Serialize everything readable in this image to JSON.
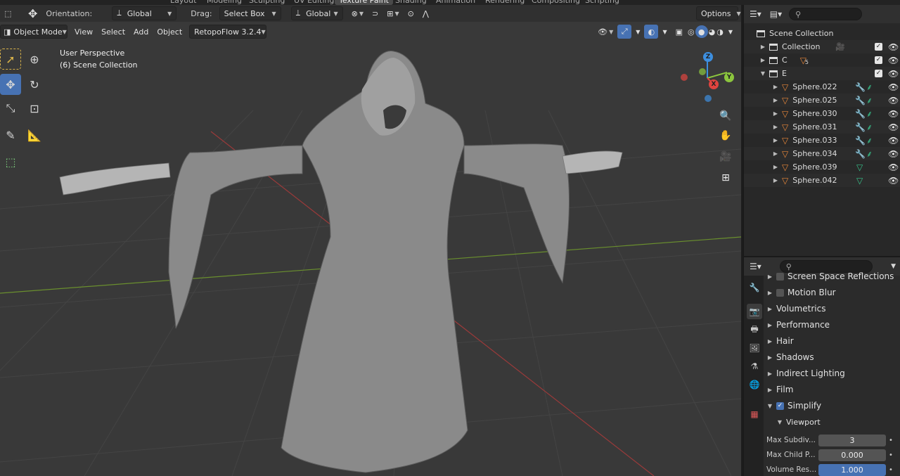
{
  "workspace_tabs": [
    "Layout",
    "Modeling",
    "Sculpting",
    "UV Editing",
    "Texture Paint",
    "Shading",
    "Animation",
    "Rendering",
    "Compositing",
    "Scripting"
  ],
  "active_workspace": "Texture Paint",
  "tool_header": {
    "orientation_label": "Orientation:",
    "orientation_value": "Global",
    "drag_label": "Drag:",
    "drag_value": "Select Box",
    "transform_value": "Global",
    "options_label": "Options"
  },
  "view_header": {
    "mode": "Object Mode",
    "menus": [
      "View",
      "Select",
      "Add",
      "Object"
    ],
    "addon": "RetopoFlow 3.2.4"
  },
  "overlay": {
    "line1": "User Perspective",
    "line2": "(6) Scene Collection"
  },
  "gizmo": {
    "x": "X",
    "y": "Y",
    "z": "Z"
  },
  "outliner": {
    "root": "Scene Collection",
    "collections": [
      {
        "name": "Collection",
        "expanded": false
      },
      {
        "name": "C",
        "expanded": false,
        "badge": "5"
      },
      {
        "name": "E",
        "expanded": true
      }
    ],
    "objects": [
      {
        "name": "Sphere.022",
        "modifier": true
      },
      {
        "name": "Sphere.025",
        "modifier": true
      },
      {
        "name": "Sphere.030",
        "modifier": true
      },
      {
        "name": "Sphere.031",
        "modifier": true
      },
      {
        "name": "Sphere.033",
        "modifier": true
      },
      {
        "name": "Sphere.034",
        "modifier": true
      },
      {
        "name": "Sphere.039",
        "modifier": false
      },
      {
        "name": "Sphere.042",
        "modifier": false
      }
    ]
  },
  "properties": {
    "sections": [
      {
        "label": "Screen Space Reflections",
        "checkbox": true,
        "checked": false
      },
      {
        "label": "Motion Blur",
        "checkbox": true,
        "checked": false
      },
      {
        "label": "Volumetrics"
      },
      {
        "label": "Performance"
      },
      {
        "label": "Hair"
      },
      {
        "label": "Shadows"
      },
      {
        "label": "Indirect Lighting"
      },
      {
        "label": "Film"
      },
      {
        "label": "Simplify",
        "checkbox": true,
        "checked": true,
        "expanded": true
      }
    ],
    "subsection": "Viewport",
    "fields": [
      {
        "label": "Max Subdiv...",
        "value": "3"
      },
      {
        "label": "Max Child P...",
        "value": "0.000"
      },
      {
        "label": "Volume Res...",
        "value": "1.000",
        "selected": true
      }
    ]
  },
  "colors": {
    "accent": "#4772b3",
    "x_axis": "#e0443f",
    "y_axis": "#8cc63e",
    "z_axis": "#3d8fe0",
    "mesh": "#e8873a"
  }
}
